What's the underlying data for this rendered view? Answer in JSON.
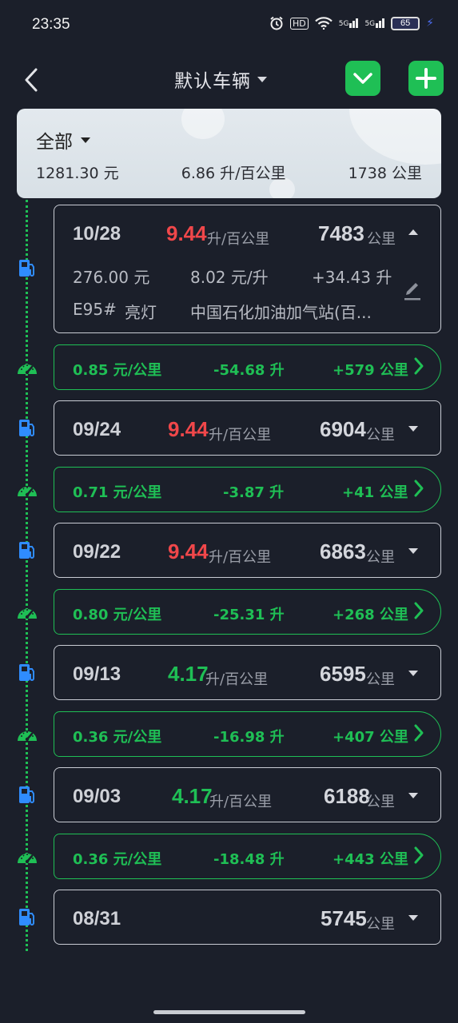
{
  "status": {
    "time": "23:35",
    "battery": "65",
    "signal1": "5G",
    "signal2": "5G",
    "hd": "HD"
  },
  "header": {
    "title": "默认车辆"
  },
  "summary": {
    "label": "全部",
    "cost": "1281.30 元",
    "consumption": "6.86 升/百公里",
    "distance": "1738 公里"
  },
  "records": [
    {
      "date": "10/28",
      "consumption": "9.44",
      "cons_unit": "升/百公里",
      "odometer": "7483",
      "odo_unit": "公里",
      "color": "#f0474a",
      "expanded": true,
      "amount": "276.00 元",
      "price": "8.02 元/升",
      "volume": "+34.43 升",
      "fuel_type": "E95#",
      "light": "亮灯",
      "station": "中国石化加油加气站(百..."
    },
    {
      "date": "09/24",
      "consumption": "9.44",
      "cons_unit": "升/百公里",
      "odometer": "6904",
      "odo_unit": "公里",
      "color": "#f0474a"
    },
    {
      "date": "09/22",
      "consumption": "9.44",
      "cons_unit": "升/百公里",
      "odometer": "6863",
      "odo_unit": "公里",
      "color": "#f0474a"
    },
    {
      "date": "09/13",
      "consumption": "4.17",
      "cons_unit": "升/百公里",
      "odometer": "6595",
      "odo_unit": "公里",
      "color": "#1fbf55"
    },
    {
      "date": "09/03",
      "consumption": "4.17",
      "cons_unit": "升/百公里",
      "odometer": "6188",
      "odo_unit": "公里",
      "color": "#1fbf55"
    },
    {
      "date": "08/31",
      "odometer": "5745",
      "odo_unit": "公里"
    }
  ],
  "segments": [
    {
      "cost_per_km": "0.85 元/公里",
      "fuel_delta": "-54.68 升",
      "distance": "+579 公里"
    },
    {
      "cost_per_km": "0.71 元/公里",
      "fuel_delta": "-3.87 升",
      "distance": "+41 公里"
    },
    {
      "cost_per_km": "0.80 元/公里",
      "fuel_delta": "-25.31 升",
      "distance": "+268 公里"
    },
    {
      "cost_per_km": "0.36 元/公里",
      "fuel_delta": "-16.98 升",
      "distance": "+407 公里"
    },
    {
      "cost_per_km": "0.36 元/公里",
      "fuel_delta": "-18.48 升",
      "distance": "+443 公里"
    }
  ],
  "colors": {
    "accent": "#1fbf55",
    "high": "#f0474a",
    "pump_icon": "#2f8cff",
    "background": "#1b1f2a"
  },
  "icons": {
    "back": "back-arrow-icon",
    "dropdown": "chevron-down-icon",
    "add": "plus-icon",
    "pump": "fuel-pump-icon",
    "gauge": "speedometer-icon",
    "edit": "pencil-icon"
  }
}
